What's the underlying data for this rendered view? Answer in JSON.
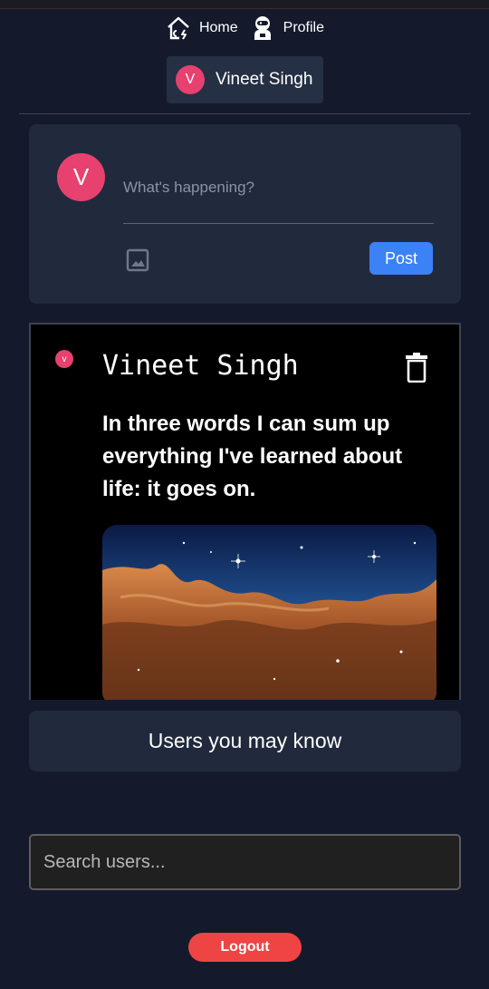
{
  "nav": {
    "home_label": "Home",
    "profile_label": "Profile",
    "home_icon": "home-icon",
    "profile_icon": "astronaut-icon"
  },
  "current_user": {
    "initial": "V",
    "name": "Vineet Singh",
    "avatar_color": "#e7416f"
  },
  "composer": {
    "initial": "V",
    "placeholder": "What's happening?",
    "value": "",
    "post_label": "Post",
    "image_icon": "image-icon"
  },
  "post": {
    "avatar_initial": "v",
    "author": "Vineet Singh",
    "text": "In three words I can sum up everything I've learned about life: it goes on.",
    "delete_icon": "trash-icon"
  },
  "suggestions": {
    "title": "Users you may know"
  },
  "search": {
    "placeholder": "Search users...",
    "value": ""
  },
  "logout_label": "Logout",
  "colors": {
    "background": "#141a2c",
    "card": "#212a3c",
    "accent": "#3b82f6",
    "danger": "#ef4444",
    "avatar": "#e7416f"
  }
}
